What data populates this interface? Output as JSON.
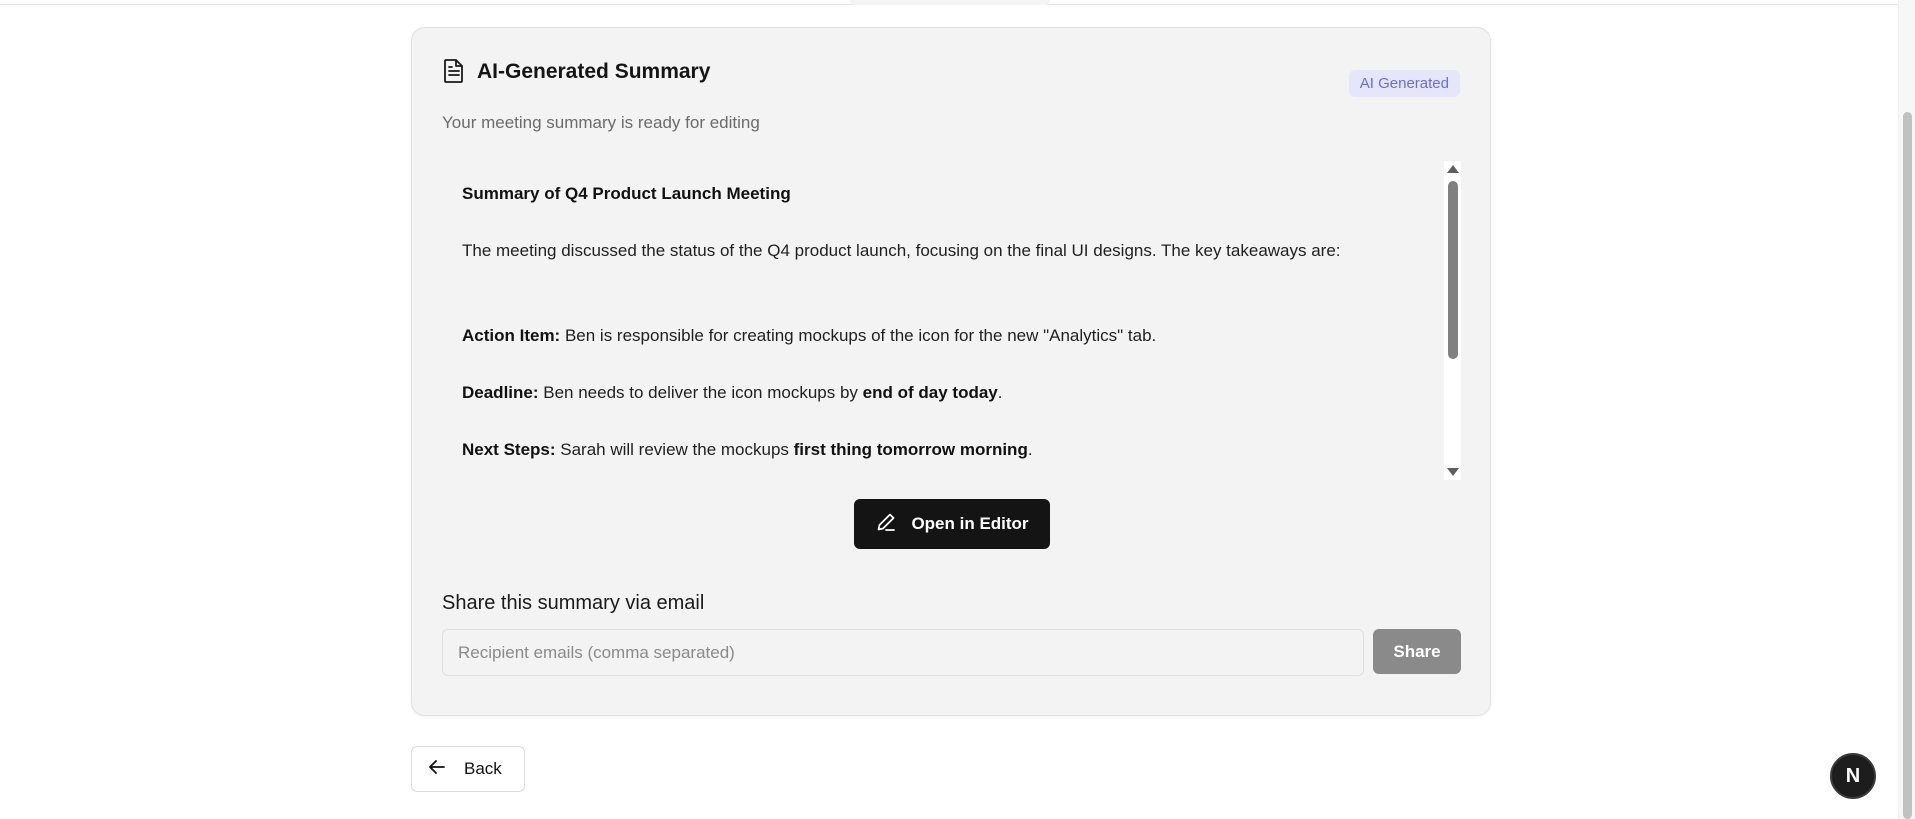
{
  "card": {
    "title": "AI-Generated Summary",
    "subtitle": "Your meeting summary is ready for editing",
    "badge": "AI Generated"
  },
  "summary": {
    "heading": "Summary of Q4 Product Launch Meeting",
    "intro": "The meeting discussed the status of the Q4 product launch, focusing on the final UI designs. The key takeaways are:",
    "action_label": "Action Item:",
    "action_text": " Ben is responsible for creating mockups of the icon for the new \"Analytics\" tab.",
    "deadline_label": "Deadline:",
    "deadline_text": " Ben needs to deliver the icon mockups by ",
    "deadline_emphasis": "end of day today",
    "deadline_end": ".",
    "next_label": "Next Steps:",
    "next_text": " Sarah will review the mockups ",
    "next_emphasis": "first thing tomorrow morning",
    "next_end": "."
  },
  "editor_button": {
    "label": "Open in Editor",
    "icon": "pencil-icon"
  },
  "share": {
    "heading": "Share this summary via email",
    "placeholder": "Recipient emails (comma separated)",
    "value": "",
    "button_label": "Share"
  },
  "back_button": {
    "label": "Back",
    "icon": "arrow-left-icon"
  },
  "corner_badge": {
    "letter": "N"
  },
  "colors": {
    "card_bg": "#f3f3f3",
    "badge_bg": "#e6e6fb",
    "badge_text": "#6b6be0",
    "primary_button": "#141414",
    "share_button": "#8a8a8a"
  }
}
